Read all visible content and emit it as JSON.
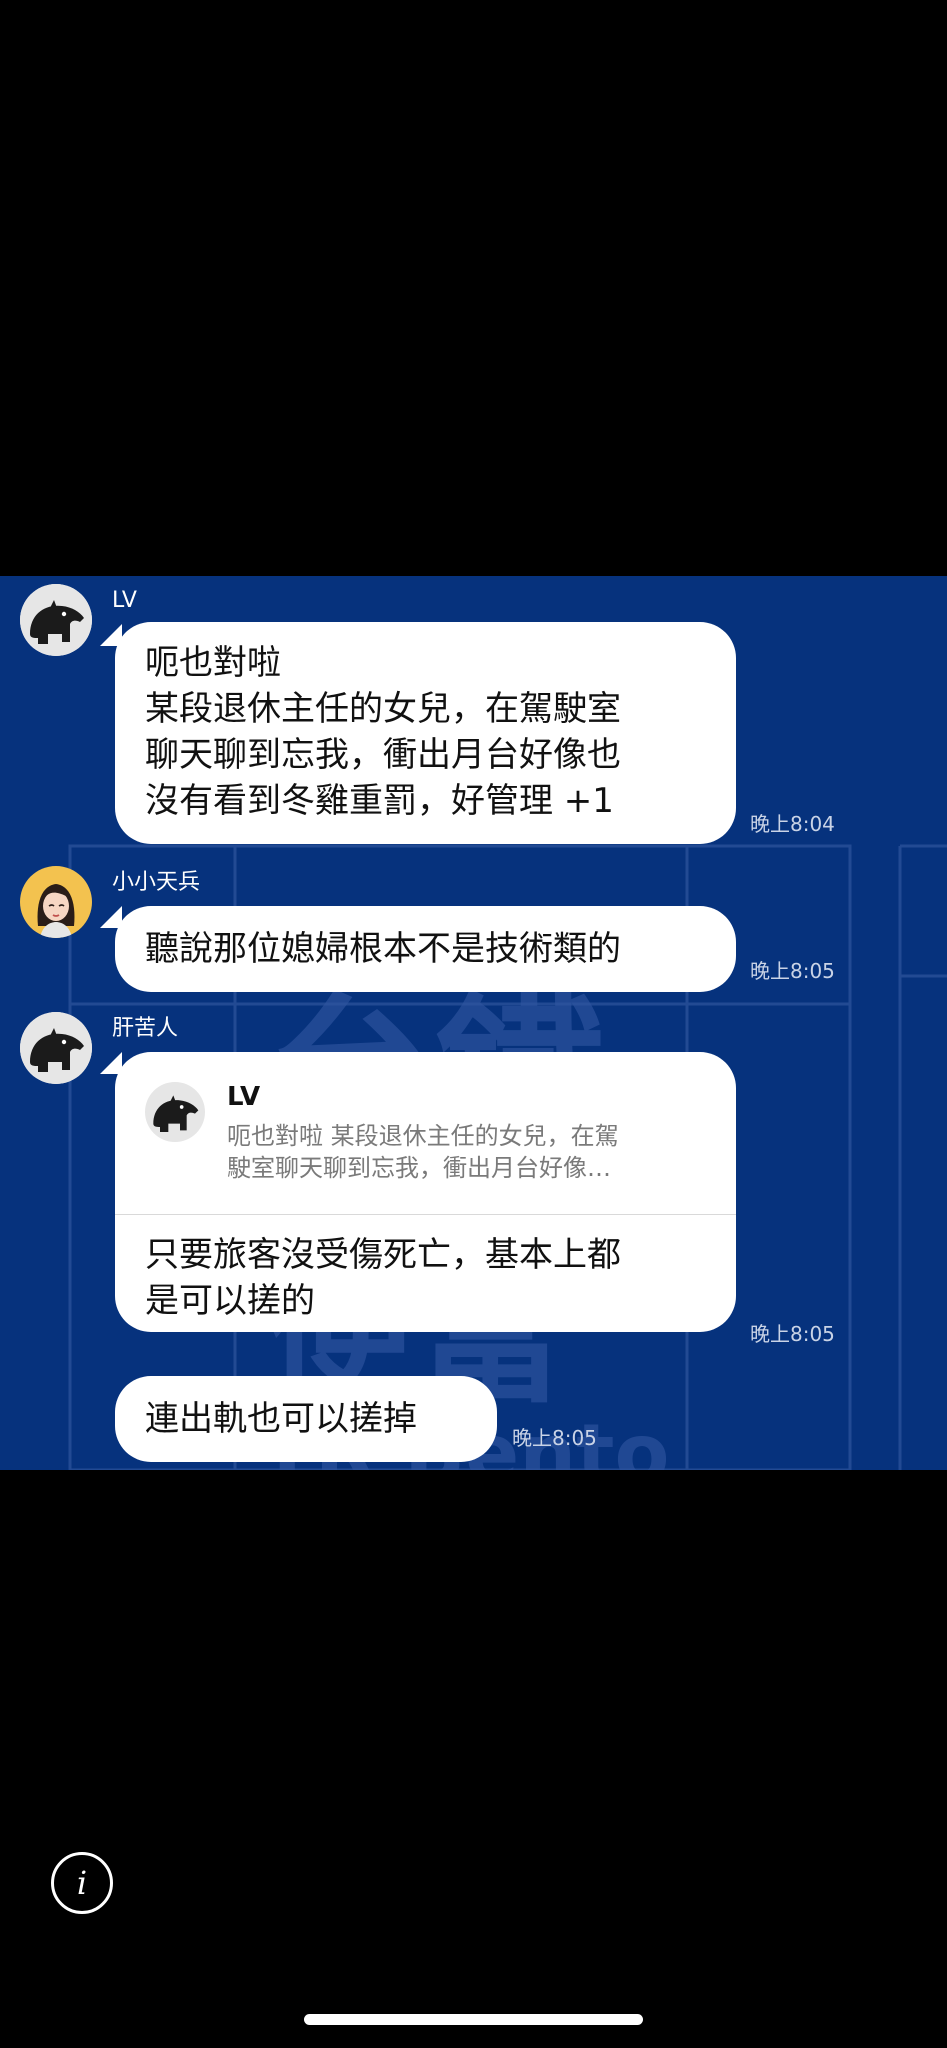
{
  "messages": [
    {
      "sender": "LV",
      "lines": [
        "呃也對啦",
        "某段退休主任的女兒，在駕駛室",
        "聊天聊到忘我，衝出月台好像也",
        "沒有看到冬雞重罰，好管理 +1"
      ],
      "time": "晚上8:04"
    },
    {
      "sender": "小小天兵",
      "lines": [
        "聽說那位媳婦根本不是技術類的"
      ],
      "time": "晚上8:05"
    },
    {
      "sender": "肝苦人",
      "reply_to": {
        "name": "LV",
        "lines": [
          "呃也對啦 某段退休主任的女兒，在駕",
          "駛室聊天聊到忘我，衝出月台好像…"
        ]
      },
      "lines": [
        "只要旅客沒受傷死亡，基本上都",
        "是可以搓的"
      ],
      "time": "晚上8:05"
    },
    {
      "sender": "",
      "lines": [
        "連出軌也可以搓掉"
      ],
      "time": "晚上8:05"
    }
  ],
  "background_sign": {
    "text_top": "台鐵",
    "text_mid": "便當",
    "text_bottom": "TR Bento"
  },
  "info_button": {
    "label": "i"
  },
  "colors": {
    "chat_background": "#06327d",
    "bubble": "#ffffff",
    "timestamp": "#c9d3e6",
    "screen": "#000000"
  },
  "icons": {
    "avatar_lv": "tapir-icon",
    "avatar_xiaoxiao": "girl-avatar-icon",
    "avatar_gankuren": "tapir-icon",
    "info": "info-icon"
  }
}
